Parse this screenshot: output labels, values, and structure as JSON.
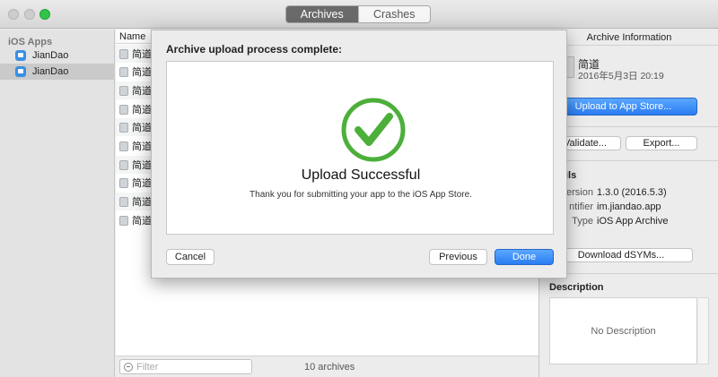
{
  "window": {
    "tabs": [
      {
        "label": "Archives",
        "active": true
      },
      {
        "label": "Crashes",
        "active": false
      }
    ]
  },
  "sidebar": {
    "header": "iOS Apps",
    "items": [
      {
        "label": "JianDao",
        "selected": false
      },
      {
        "label": "JianDao",
        "selected": true
      }
    ]
  },
  "list": {
    "column_header": "Name",
    "rows": [
      "简道",
      "简道",
      "简道",
      "简道",
      "简道",
      "简道",
      "简道",
      "简道",
      "简道",
      "简道"
    ],
    "filter_placeholder": "Filter",
    "count_label": "10 archives"
  },
  "inspector": {
    "title": "Archive Information",
    "app_name": "简道",
    "date": "2016年5月3日 20:19",
    "upload_button": "Upload to App Store...",
    "validate_button": "Validate...",
    "export_button": "Export...",
    "details_header": "ils",
    "version_label": "Version",
    "version_value": "1.3.0 (2016.5.3)",
    "identifier_label": "ntifier",
    "identifier_value": "im.jiandao.app",
    "type_label": "Type",
    "type_value": "iOS App Archive",
    "dsym_button": "Download dSYMs...",
    "description_header": "Description",
    "description_placeholder": "No Description"
  },
  "sheet": {
    "title": "Archive upload process complete:",
    "heading": "Upload Successful",
    "message": "Thank you for submitting your app to the iOS App Store.",
    "cancel_button": "Cancel",
    "previous_button": "Previous",
    "done_button": "Done",
    "check_color": "#4caf3a"
  }
}
